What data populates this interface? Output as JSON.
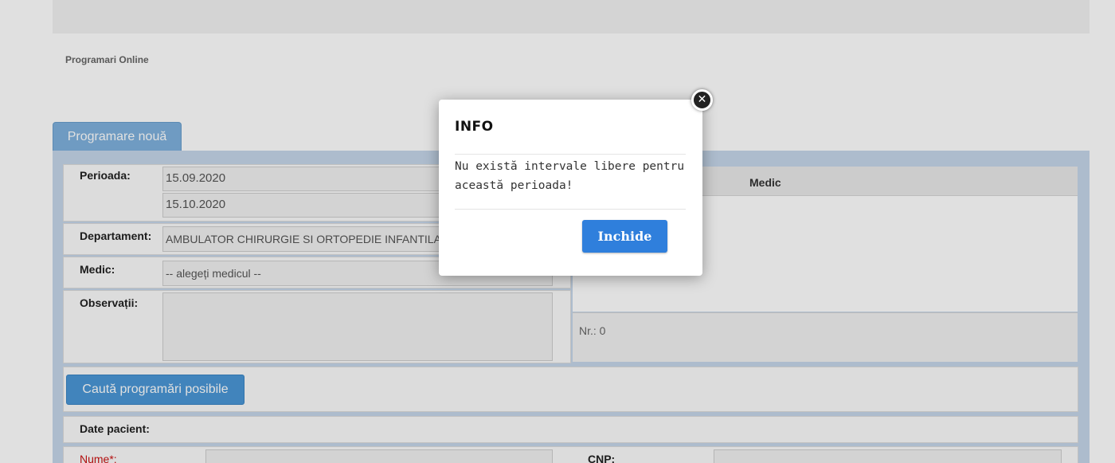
{
  "breadcrumb": "Programari Online",
  "tab_label": "Programare nouă",
  "form": {
    "period_label": "Perioada:",
    "period_start": "15.09.2020",
    "period_end": "15.10.2020",
    "department_label": "Departament:",
    "department_value": "AMBULATOR CHIRURGIE SI ORTOPEDIE INFANTILA",
    "doctor_label": "Medic:",
    "doctor_value": "-- alegeți medicul --",
    "notes_label": "Observații:",
    "search_button": "Caută programări posibile",
    "patient_section_label": "Date pacient:",
    "name_label": "Nume*:",
    "cnp_label": "CNP:"
  },
  "table": {
    "column_medic": "Medic",
    "count_label": "Nr.: 0"
  },
  "modal": {
    "title": "INFO",
    "message": "Nu există intervale libere pentru această perioada!",
    "close_button": "Inchide",
    "close_icon": "close-circle-icon"
  }
}
